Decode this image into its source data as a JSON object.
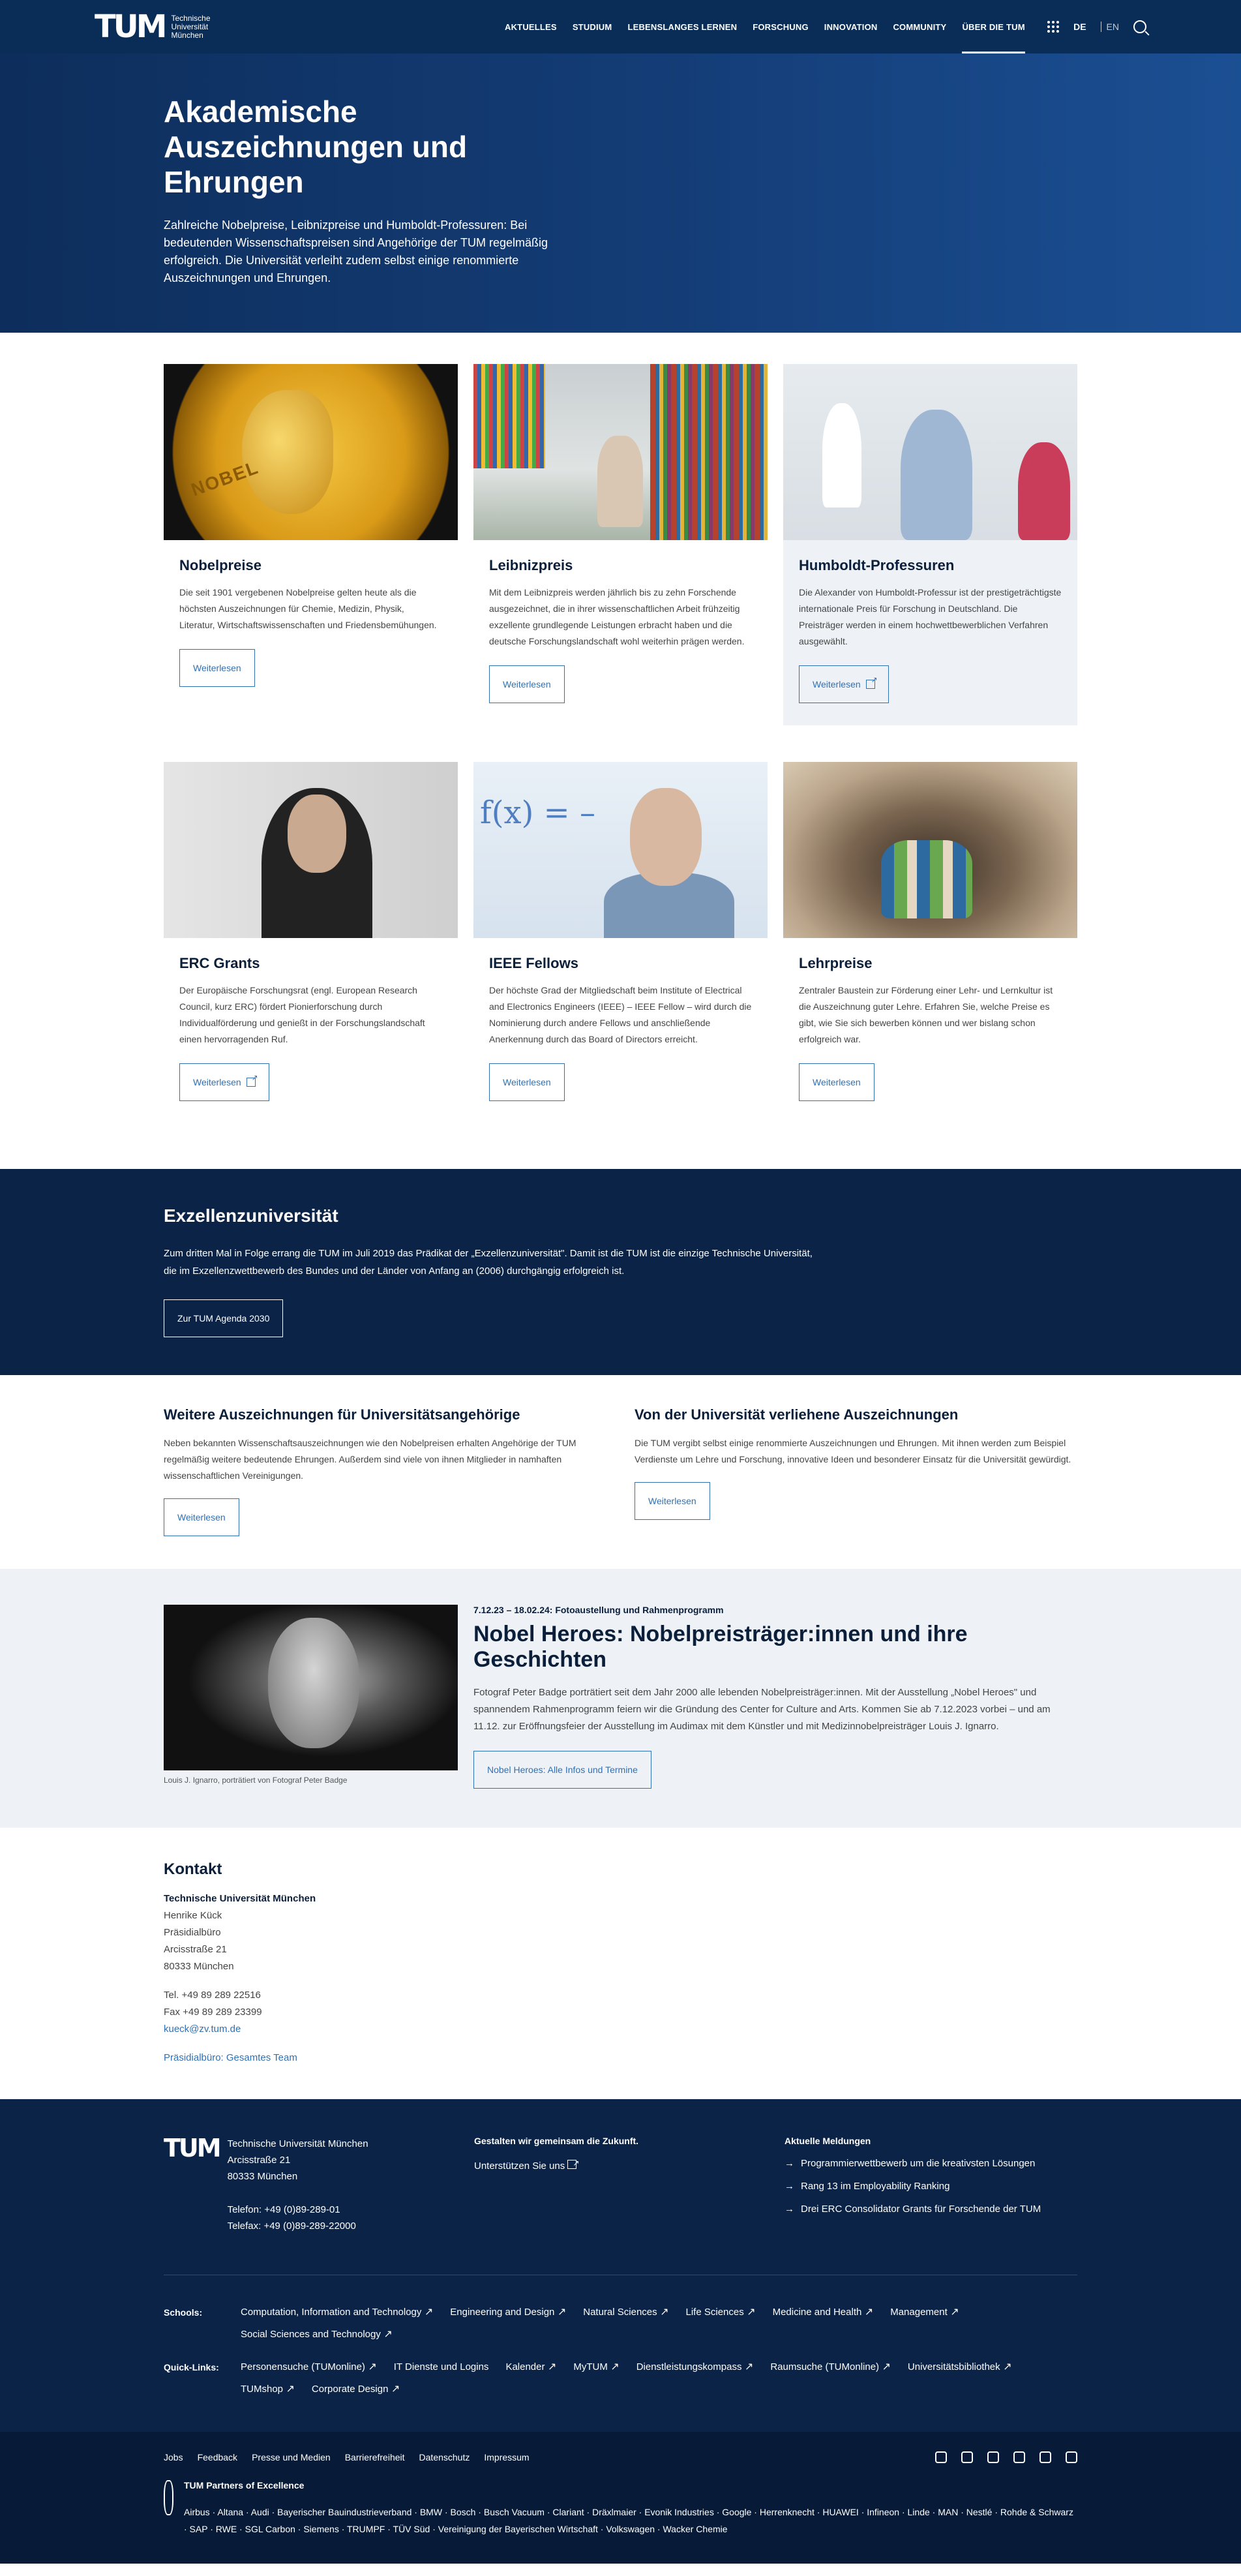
{
  "header": {
    "logo_text": "Technische\nUniversität\nMünchen",
    "nav": [
      "AKTUELLES",
      "STUDIUM",
      "LEBENSLANGES LERNEN",
      "FORSCHUNG",
      "INNOVATION",
      "COMMUNITY",
      "ÜBER DIE TUM"
    ],
    "active_nav": "ÜBER DIE TUM",
    "lang_de": "DE",
    "lang_en": "EN"
  },
  "hero": {
    "title": "Akademische Auszeichnungen und Ehrungen",
    "intro": "Zahlreiche Nobelpreise, Leibnizpreise und Humboldt-Professuren: Bei bedeutenden Wissenschaftspreisen sind Angehörige der TUM regelmäßig erfolgreich. Die Universität verleiht zudem selbst einige re­nommierte Auszeichnungen und Ehrungen."
  },
  "cards": [
    {
      "title": "Nobelpreise",
      "text": "Die seit 1901 vergebenen Nobelpreise gelten heute als die höchsten Auszeichnungen für Chemie, Medizin, Physik, Literatur, Wirtschaftswissenschaften und Friedensbemühungen.",
      "button": "Weiterlesen"
    },
    {
      "title": "Leibnizpreis",
      "text": "Mit dem Leibnizpreis werden jährlich bis zu zehn Forschende ausgezeichnet, die in ihrer wissenschaftlichen Arbeit frühzeitig exzellente grundlegende Leistungen erbracht haben und die deutsche Forschungslandschaft wohl weiterhin prägen werden.",
      "button": "Weiterlesen"
    },
    {
      "title": "Humboldt-Professuren",
      "text": "Die Alexander von Humboldt-Professur ist der prestigeträchtigste internationale Preis für Forschung in Deutschland. Die Preisträger werden in einem hoch­wettbewerblichen Verfahren ausgewählt.",
      "button": "Weiterlesen"
    },
    {
      "title": "ERC Grants",
      "text": "Der Europäische Forschungsrat (engl. European Research Council, kurz ERC) fördert Pionierforschung durch Individualförderung und genießt in der Forschungslandschaft einen hervorragenden Ruf.",
      "button": "Weiterlesen"
    },
    {
      "title": "IEEE Fellows",
      "text": "Der höchste Grad der Mitgliedschaft beim Institute of Electrical and Electronics Engineers (IEEE) – IEEE Fellow – wird durch die Nominierung durch andere Fellows und anschließende Anerkennung durch das Board of Directors erreicht.",
      "button": "Weiterlesen"
    },
    {
      "title": "Lehrpreise",
      "text": "Zentraler Baustein zur Förderung einer Lehr- und Lernkultur ist die Auszeichnung guter Lehre. Erfahren Sie, welche Preise es gibt, wie Sie sich bewerben können und wer bislang schon erfolgreich war.",
      "button": "Weiterlesen"
    }
  ],
  "excellence": {
    "title": "Exzellenzuniversität",
    "text": "Zum dritten Mal in Folge errang die TUM im Juli 2019 das Prädikat der „Exzellenzuniversität\". Damit ist die TUM ist die einzige Technische Universität, die im Exzellenzwettbewerb des Bundes und der Länder von Anfang an (2006) durchgängig erfolgreich ist.",
    "button": "Zur TUM Agenda 2030"
  },
  "more": [
    {
      "title": "Weitere Auszeichnungen für Universitätsangehörige",
      "text": "Neben bekannten Wissenschaftsauszeichnungen wie den Nobelpreisen erhalten Angehörige der TUM regelmäßig weitere bedeutende Ehrungen. Außerdem sind viele von ihnen Mitglieder in namhaften wissenschaftlichen Vereinigungen.",
      "button": "Weiterlesen"
    },
    {
      "title": "Von der Universität verliehene Auszeichnungen",
      "text": "Die TUM vergibt selbst einige renommierte Auszeichnungen und Ehrungen. Mit ihnen werden zum Beispiel Verdienste um Lehre und Forschung, innovative Ideen und besonderer Einsatz für die Universität gewürdigt.",
      "button": "Weiterlesen"
    }
  ],
  "nobel_heroes": {
    "caption": "Louis J. Ignarro, porträtiert von Fotograf Peter Badge",
    "kicker": "7.12.23 – 18.02.24: Fotoaustellung und Rahmenprogramm",
    "title": "Nobel Heroes: Nobelpreisträger:innen und ihre Geschichten",
    "text": "Fotograf Peter Badge porträtiert seit dem Jahr 2000 alle lebenden Nobelpreisträger:innen. Mit der Ausstellung „Nobel Heroes\" und spannendem Rahmenprogramm feiern wir die Gründung des Center for Culture and Arts. Kommen Sie ab 7.12.2023 vorbei – und am 11.12. zur Eröffnungsfeier der Ausstellung im Audimax mit dem Künstler und mit Medizinnobelpreisträger Louis J. Ignarro.",
    "button": "Nobel Heroes: Alle Infos und Termine"
  },
  "contact": {
    "title": "Kontakt",
    "org": "Technische Universität München",
    "name": "Henrike Kück",
    "office": "Präsidialbüro",
    "street": "Arcisstraße 21",
    "city": "80333 München",
    "tel": "Tel. +49 89 289 22516",
    "fax": "Fax +49 89 289 23399",
    "email": "kueck@zv.tum.de",
    "team_link": "Präsidialbüro: Gesamtes Team"
  },
  "footer": {
    "org": "Technische Universität München",
    "street": "Arcisstraße 21",
    "city": "80333 München",
    "phone": "Telefon: +49 (0)89-289-01",
    "fax": "Telefax: +49 (0)89-289-22000",
    "together_title": "Gestalten wir gemeinsam die Zukunft.",
    "support_link": "Unterstützen Sie uns",
    "news_title": "Aktuelle Meldungen",
    "news": [
      "Programmierwettbewerb um die kreativsten Lösungen",
      "Rang 13 im Employability Ranking",
      "Drei ERC Consolidator Grants für Forschende der TUM"
    ],
    "schools_label": "Schools:",
    "schools": [
      "Computation, Information and Technology",
      "Engineering and Design",
      "Natural Sciences",
      "Life Sciences",
      "Medicine and Health",
      "Management",
      "Social Sciences and Technology"
    ],
    "quick_label": "Quick-Links:",
    "quick": [
      "Personensuche (TUMonline)",
      "IT Dienste und Logins",
      "Kalender",
      "MyTUM",
      "Dienstleistungskompass",
      "Raumsuche (TUMonline)",
      "Universitätsbibliothek",
      "TUMshop",
      "Corporate Design"
    ],
    "legal": [
      "Jobs",
      "Feedback",
      "Presse und Medien",
      "Barrierefreiheit",
      "Datenschutz",
      "Impressum"
    ],
    "partners_title": "TUM Partners of Excellence",
    "partners": "Airbus · Altana · Audi · Bayerischer Bauindustrieverband · BMW · Bosch · Busch Vacuum · Clariant · Dräxlmaier · Evonik Industries · Google · Herrenknecht · HUAWEI · Infineon · Linde · MAN · Nestlé · Rohde & Schwarz · SAP · RWE · SGL Carbon · Siemens · TRUMPF · TÜV Süd · Vereinigung der Bayerischen Wirtschaft · Volkswagen · Wacker Chemie"
  }
}
